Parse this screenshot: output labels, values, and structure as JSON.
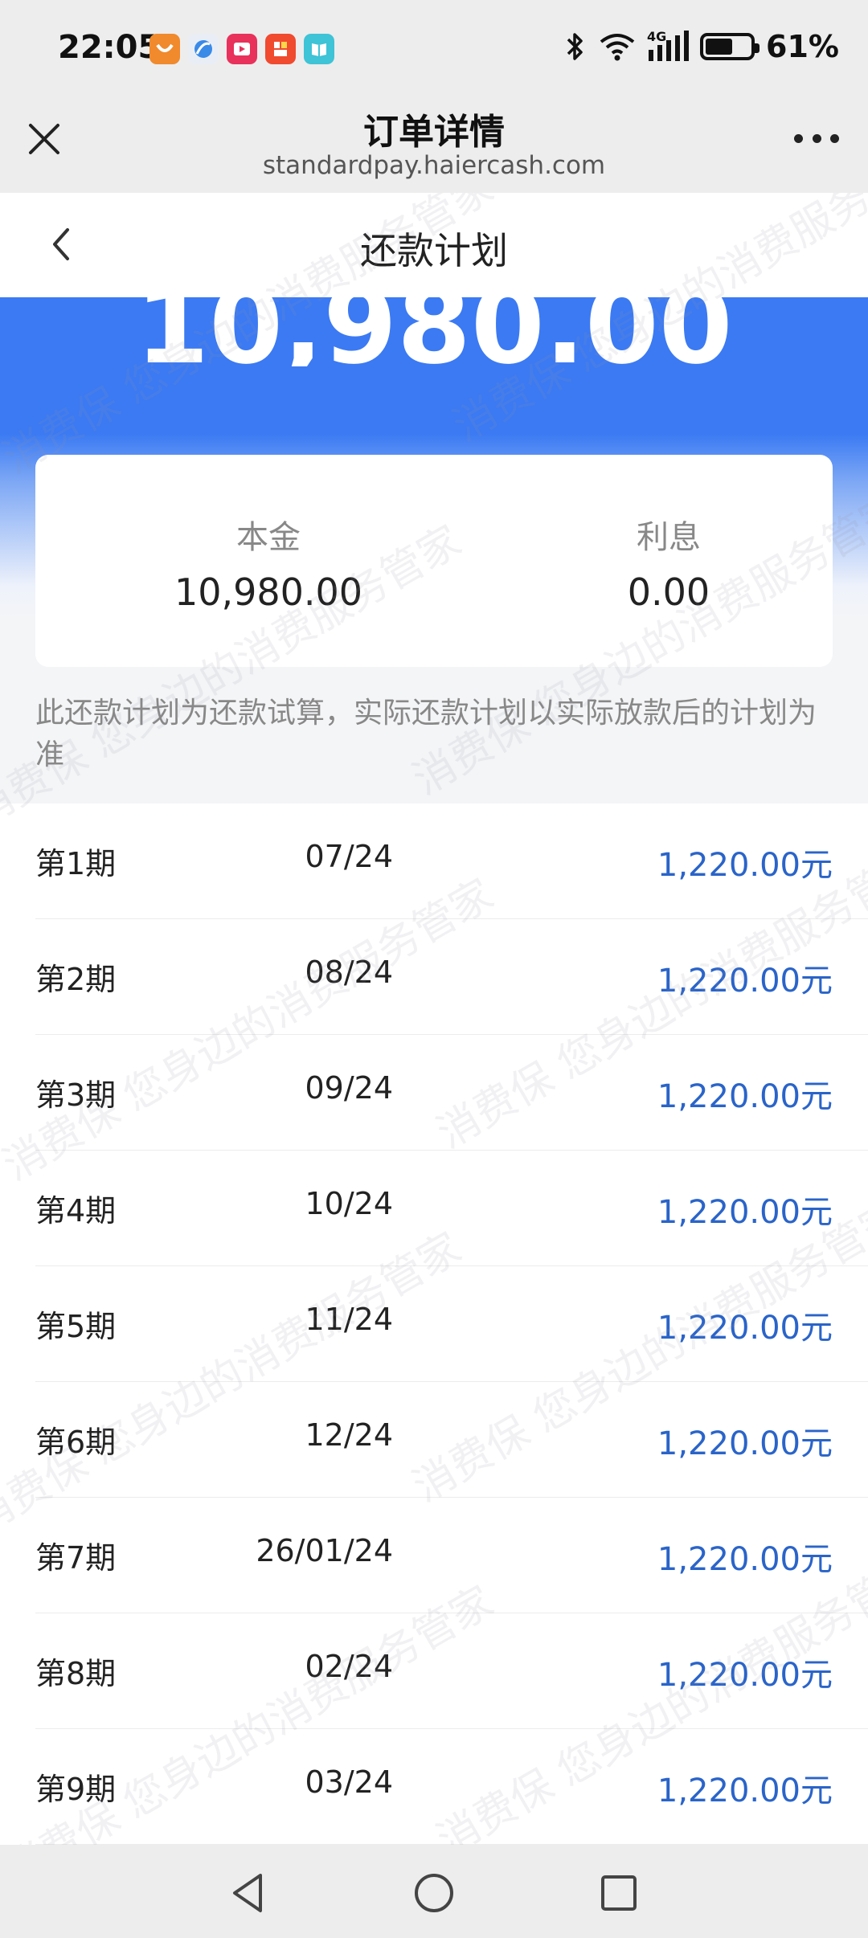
{
  "status_bar": {
    "time": "22:05",
    "app_icons": [
      "app-icon-orange",
      "app-icon-browser",
      "app-icon-video",
      "app-icon-red",
      "app-icon-book"
    ],
    "network": "4G",
    "battery_text": "61%",
    "battery_level": 0.61
  },
  "browser": {
    "title": "订单详情",
    "url": "standardpay.haiercash.com"
  },
  "nav": {
    "title": "还款计划"
  },
  "header": {
    "amount": "10,980.00"
  },
  "summary": {
    "principal_label": "本金",
    "principal_value": "10,980.00",
    "interest_label": "利息",
    "interest_value": "0.00"
  },
  "notice": "此还款计划为还款试算，实际还款计划以实际放款后的计划为准",
  "plan": [
    {
      "period": "第1期",
      "date": "07/24",
      "amount": "1,220.00元"
    },
    {
      "period": "第2期",
      "date": "08/24",
      "amount": "1,220.00元"
    },
    {
      "period": "第3期",
      "date": "09/24",
      "amount": "1,220.00元"
    },
    {
      "period": "第4期",
      "date": "10/24",
      "amount": "1,220.00元"
    },
    {
      "period": "第5期",
      "date": "11/24",
      "amount": "1,220.00元"
    },
    {
      "period": "第6期",
      "date": "12/24",
      "amount": "1,220.00元"
    },
    {
      "period": "第7期",
      "date": "26/01/24",
      "amount": "1,220.00元"
    },
    {
      "period": "第8期",
      "date": "02/24",
      "amount": "1,220.00元"
    },
    {
      "period": "第9期",
      "date": "03/24",
      "amount": "1,220.00元"
    }
  ],
  "watermark": "消费保 您身边的消费服务管家",
  "colors": {
    "accent": "#3b7af3",
    "amount_text": "#2a64c9"
  }
}
